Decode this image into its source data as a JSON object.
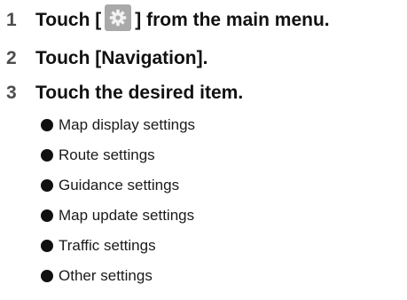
{
  "steps": [
    {
      "number": "1",
      "text_before": "Touch [",
      "icon": "gear-icon",
      "text_after": "] from the main menu."
    },
    {
      "number": "2",
      "text": "Touch [Navigation]."
    },
    {
      "number": "3",
      "text": "Touch the desired item."
    }
  ],
  "items": [
    "Map display settings",
    "Route settings",
    "Guidance settings",
    "Map update settings",
    "Traffic settings",
    "Other settings"
  ]
}
